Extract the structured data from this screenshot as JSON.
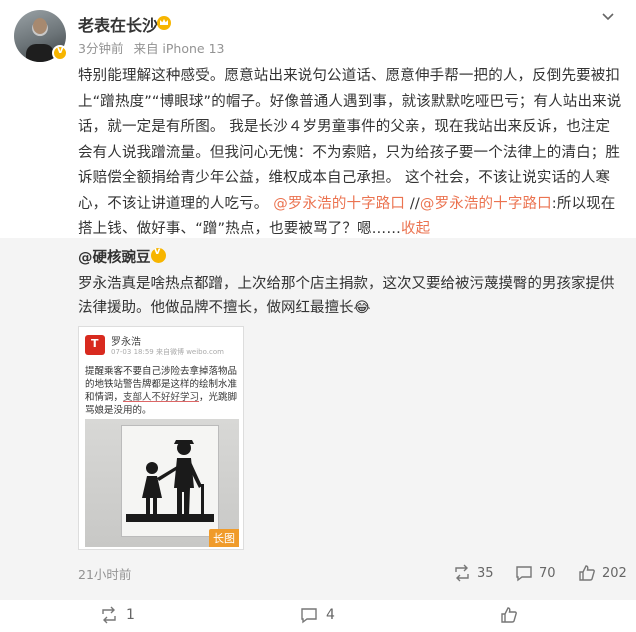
{
  "post": {
    "username": "老表在长沙",
    "time": "3分钟前",
    "source": "来自 iPhone 13",
    "text_parts": {
      "p1": "特别能理解这种感受。愿意站出来说句公道话、愿意伸手帮一把的人，反倒先要被扣上“蹭热度”“博眼球”的帽子。好像普通人遇到事，就该默默吃哑巴亏；有人站出来说话，就一定是有所图。  我是长沙４岁男童事件的父亲，现在我站出来反诉，也注定会有人说我蹭流量。但我问心无愧：不为索赔，只为给孩子要一个法律上的清白；胜诉赔偿全额捐给青少年公益，维权成本自己承担。  这个社会，不该让说实话的人寒心，不该让讲道理的人吃亏。",
      "mention1": "@罗永浩的十字路口",
      "sep": " //",
      "mention2": "@罗永浩的十字路口",
      "p2": ":所以现在搭上钱、做好事、“蹭”热点，也要被骂了？嗯……",
      "collapse": "收起"
    }
  },
  "retweet": {
    "username": "@硬核豌豆",
    "text": "罗永浩真是啥热点都蹭，上次给那个店主捐款，这次又要给被污蔑摸臀的男孩家提供法律援助。他做品牌不擅长，做网红最擅长😂",
    "thumbnail": {
      "name": "罗永浩",
      "time": "07-03 18:59 来自微博 weibo.com",
      "text_a": "提醒乘客不要自己涉险去拿掉落物品的地铁站警告牌都是这样的绘制水准和情调，",
      "text_hl": "支部人不好好学习",
      "text_b": "，光跳脚骂娘是没用的。",
      "badge": "长图"
    },
    "time": "21小时前",
    "reposts": "35",
    "comments": "70",
    "likes": "202"
  },
  "actions": {
    "reposts": "1",
    "comments": "4"
  },
  "colors": {
    "link": "#eb7350",
    "gold": "#f7b500"
  }
}
